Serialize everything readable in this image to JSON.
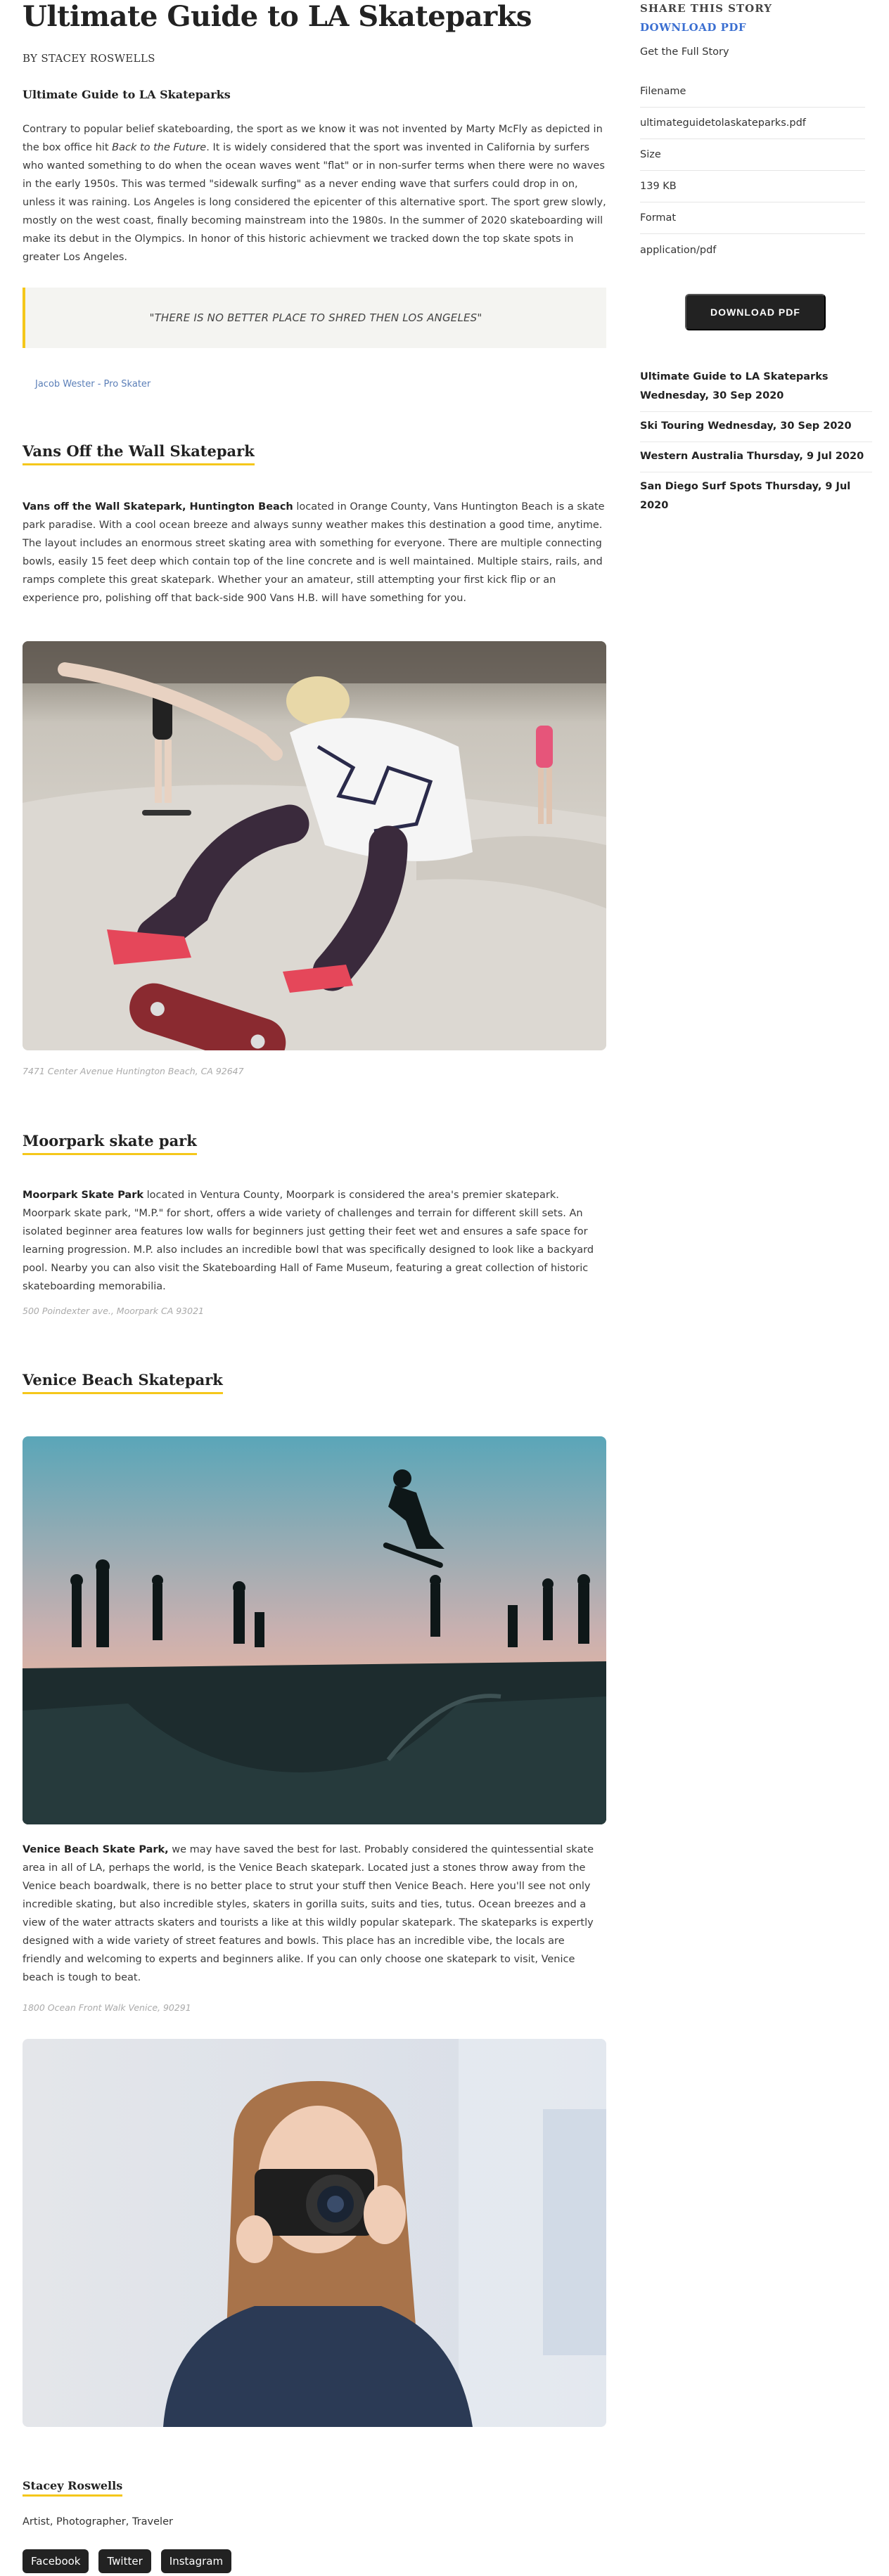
{
  "article": {
    "title": "Ultimate Guide to LA Skateparks",
    "byline": "BY STACEY ROSWELLS",
    "subtitle": "Ultimate Guide to LA Skateparks",
    "intro_1": "Contrary to popular belief skateboarding, the sport as we know it was not invented by Marty McFly as depicted in the box office hit ",
    "intro_italic": "Back to the Future",
    "intro_2": ". It is widely considered that the sport was invented in California by surfers who wanted something to do when the ocean waves went \"flat\" or in non-surfer terms when there were no waves in the early 1950s. This was termed \"sidewalk surfing\" as a never ending wave that surfers could drop in on, unless it was raining. Los Angeles is long considered the epicenter of this alternative sport. The sport grew slowly, mostly on the west coast, finally becoming mainstream into the 1980s. In the summer of 2020 skateboarding will make its debut in the Olympics. In honor of this historic achievment we tracked down the top skate spots in greater Los Angeles.",
    "quote": "\"THERE IS NO BETTER PLACE TO SHRED THEN LOS ANGELES\"",
    "quote_author": "Jacob Wester - Pro Skater",
    "sections": [
      {
        "heading": "Vans Off the Wall Skatepark",
        "lead": "Vans off the Wall Skatepark, Huntington Beach",
        "text": " located in Orange County, Vans Huntington Beach is a skate park paradise. With a cool ocean breeze and always sunny weather makes this destination a good time, anytime. The layout includes an enormous street skating area with something for everyone. There are multiple connecting bowls, easily 15 feet deep which contain top of the line concrete and is well maintained. Multiple stairs, rails, and ramps complete this great skatepark. Whether your an amateur, still attempting your first kick flip or an experience pro, polishing off that back-side 900 Vans H.B. will have something for you.",
        "caption": "7471 Center Avenue Huntington Beach, CA 92647"
      },
      {
        "heading": "Moorpark skate park",
        "lead": "Moorpark Skate Park",
        "text": " located in Ventura County, Moorpark is considered the area's premier skatepark. Moorpark skate park, \"M.P.\" for short, offers a wide variety of challenges and terrain for different skill sets. An isolated beginner area features low walls for beginners just getting their feet wet and ensures a safe space for learning progression. M.P. also includes an incredible bowl that was specifically designed to look like a backyard pool. Nearby you can also visit the Skateboarding Hall of Fame Museum, featuring a great collection of historic skateboarding memorabilia.",
        "caption": "500 Poindexter ave., Moorpark CA 93021"
      },
      {
        "heading": "Venice Beach Skatepark",
        "lead": "Venice Beach Skate Park,",
        "text": " we may have saved the best for last. Probably considered the quintessential skate area in all of LA, perhaps the world, is the Venice Beach skatepark. Located just a stones throw away from the Venice beach boardwalk, there is no better place to strut your stuff then Venice Beach. Here you'll see not only incredible skating, but also incredible styles, skaters in gorilla suits, suits and ties, tutus. Ocean breezes and a view of the water attracts skaters and tourists a like at this wildly popular skatepark. The skateparks is expertly designed with a wide variety of street features and bowls. This place has an incredible vibe, the locals are friendly and welcoming to experts and beginners alike. If you can only choose one skatepark to visit, Venice beach is tough to beat.",
        "caption": "1800 Ocean Front Walk Venice, 90291"
      }
    ]
  },
  "author": {
    "name": "Stacey Roswells",
    "bio": "Artist, Photographer, Traveler",
    "social": [
      "Facebook",
      "Twitter",
      "Instagram"
    ]
  },
  "sidebar": {
    "share_title": "SHARE THIS STORY",
    "download_link": "DOWNLOAD PDF",
    "full_story": "Get the Full Story",
    "meta": [
      "Filename",
      "ultimateguidetolaskateparks.pdf",
      "Size",
      "139 KB",
      "Format",
      "application/pdf"
    ],
    "download_button": "DOWNLOAD PDF",
    "related": [
      "Ultimate Guide to LA Skateparks Wednesday, 30 Sep 2020",
      "Ski Touring Wednesday, 30 Sep 2020",
      "Western Australia Thursday, 9 Jul 2020",
      "San Diego Surf Spots Thursday, 9 Jul 2020"
    ]
  },
  "colors": {
    "accent_yellow": "#f5c71a",
    "link_blue": "#3b6fd1",
    "button_dark": "#222222"
  }
}
